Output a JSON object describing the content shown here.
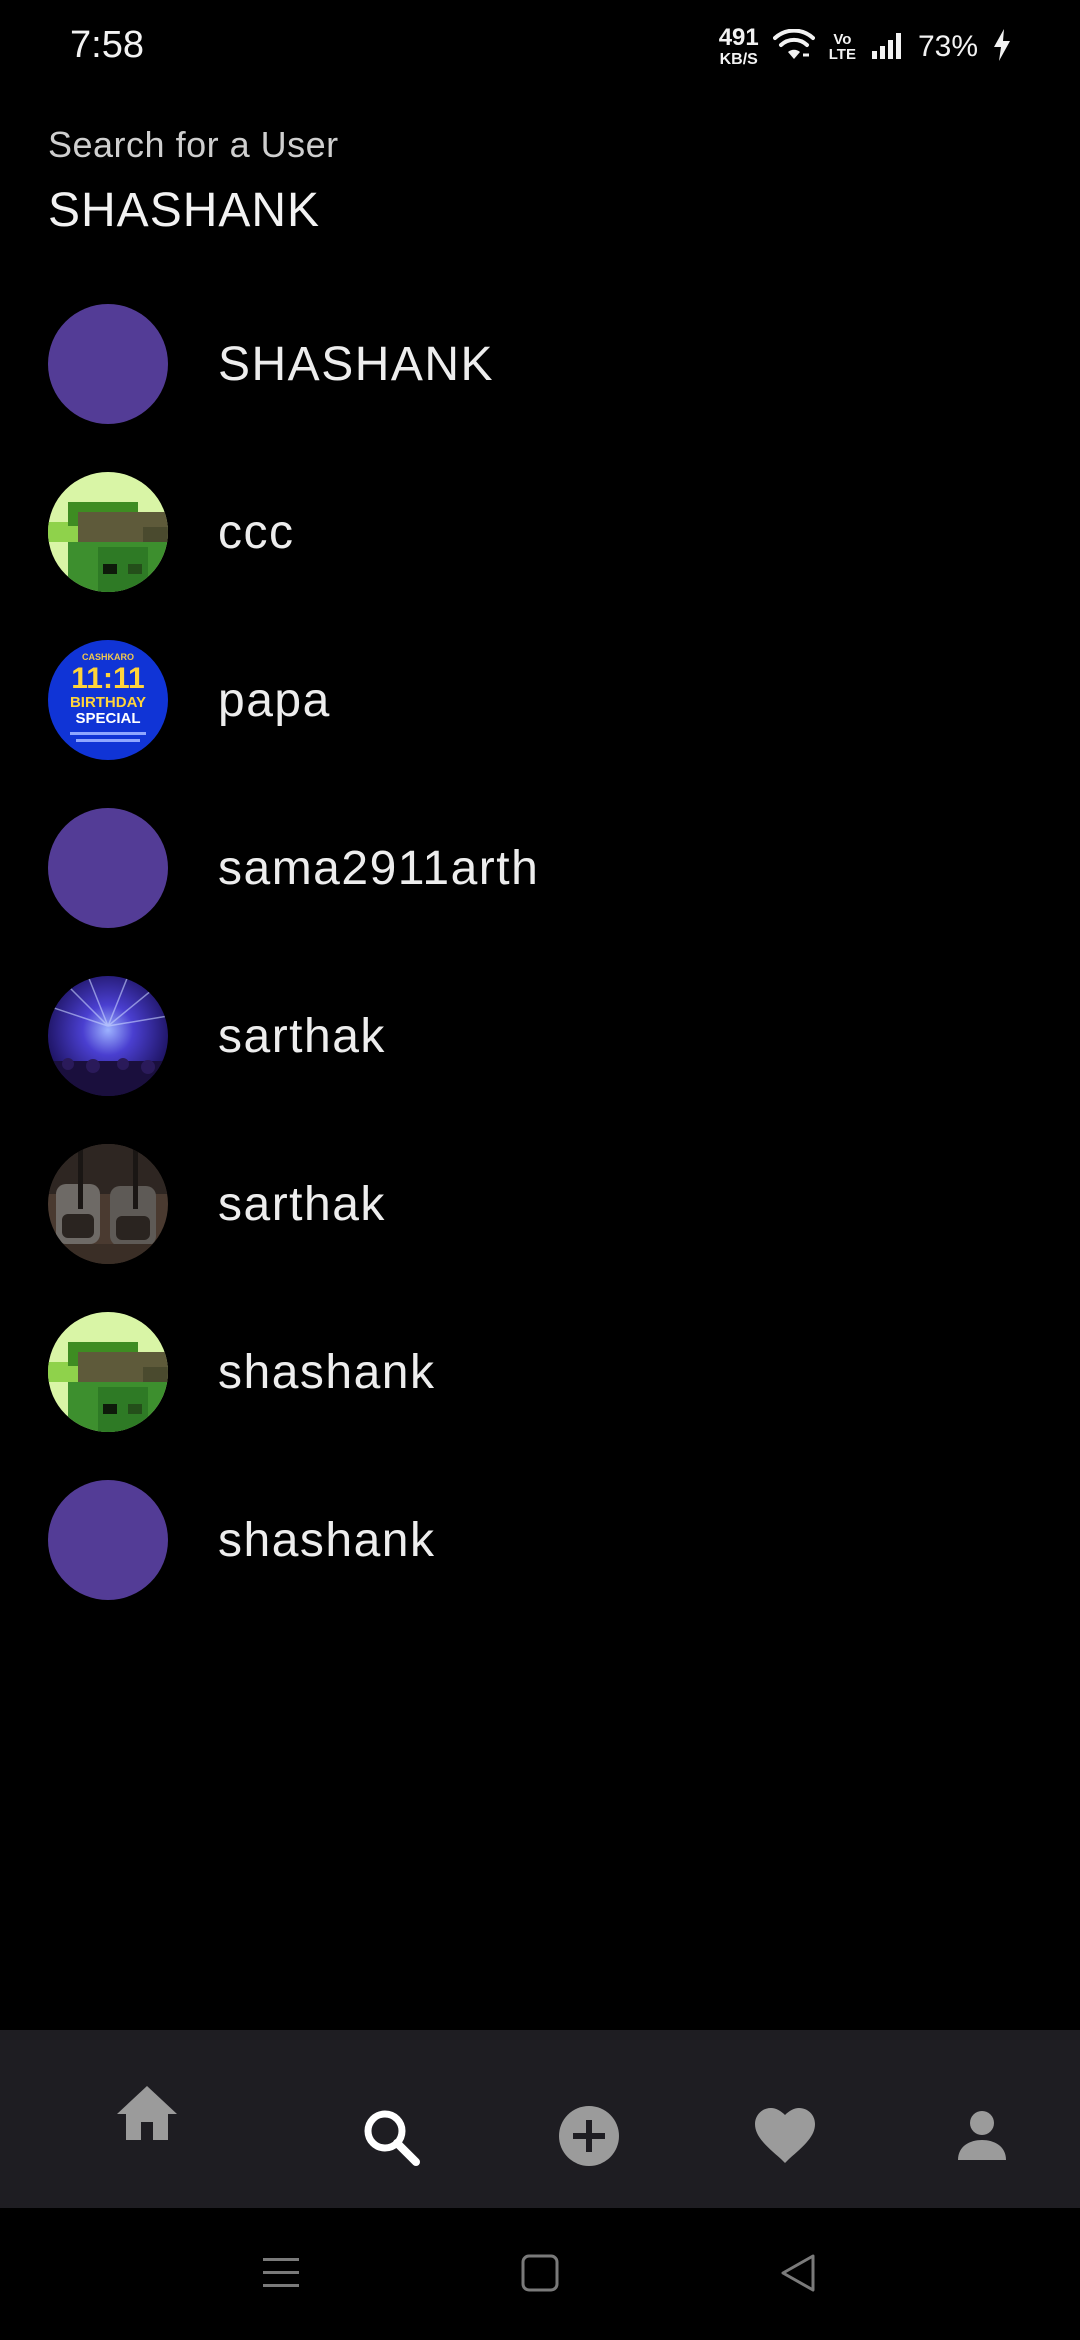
{
  "status_bar": {
    "time": "7:58",
    "net_speed_value": "491",
    "net_speed_unit": "KB/S",
    "volte_top": "Vo",
    "volte_bottom": "LTE",
    "battery": "73%"
  },
  "search": {
    "label": "Search for a User",
    "value": "SHASHANK"
  },
  "results": [
    {
      "username": "SHASHANK",
      "avatar": "placeholder-purple"
    },
    {
      "username": "ccc",
      "avatar": "pixel-art-frog"
    },
    {
      "username": "papa",
      "avatar": "birthday-special-banner"
    },
    {
      "username": "sama2911arth",
      "avatar": "placeholder-purple"
    },
    {
      "username": "sarthak",
      "avatar": "concert-lights"
    },
    {
      "username": "sarthak",
      "avatar": "drinks-photo"
    },
    {
      "username": "shashank",
      "avatar": "pixel-art-frog"
    },
    {
      "username": "shashank",
      "avatar": "placeholder-purple"
    }
  ],
  "avatar_texts": {
    "brand": "CASHKARO",
    "headline": "11:11",
    "line2": "BIRTHDAY",
    "line3": "SPECIAL"
  },
  "bottom_nav": {
    "items": [
      {
        "icon": "home-icon",
        "active": false
      },
      {
        "icon": "search-icon",
        "active": true
      },
      {
        "icon": "add-circle-icon",
        "active": false
      },
      {
        "icon": "heart-icon",
        "active": false
      },
      {
        "icon": "profile-icon",
        "active": false
      }
    ]
  },
  "colors": {
    "background": "#000000",
    "placeholder_avatar": "#533C96",
    "nav_background": "#1E1D22",
    "nav_icon": "#9B9B9B",
    "nav_icon_active": "#FFFFFF"
  }
}
